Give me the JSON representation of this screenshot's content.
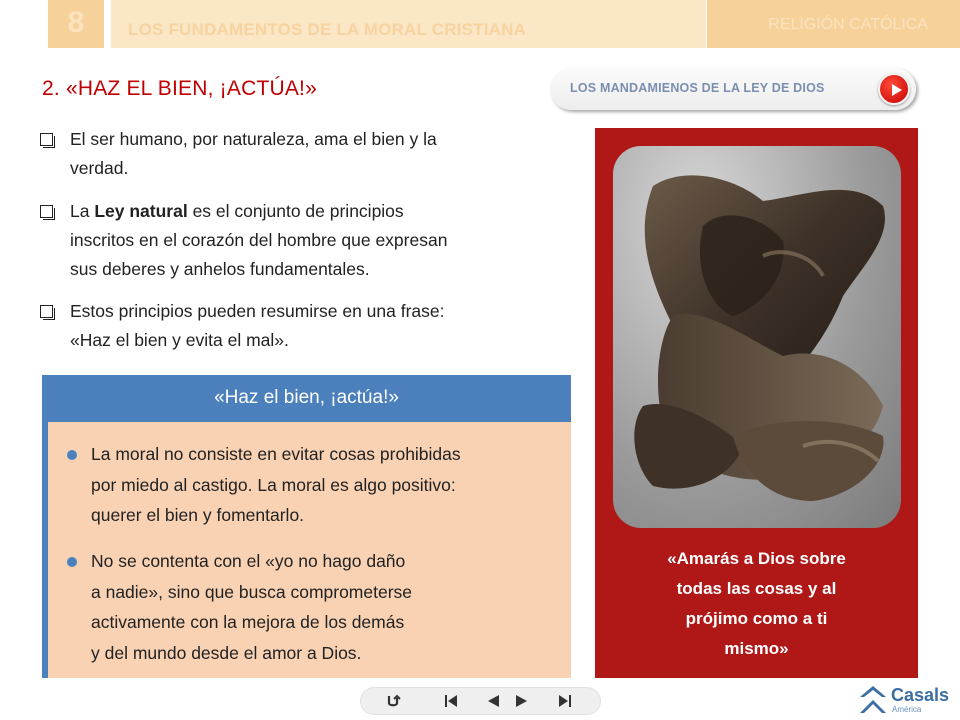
{
  "header": {
    "unit_number": "8",
    "unit_title": "LOS FUNDAMENTOS DE LA MORAL CRISTIANA",
    "subject": "RELIGIÓN CATÓLICA"
  },
  "section": {
    "title": "2. «HAZ EL BIEN, ¡ACTÚA!»"
  },
  "link_button": {
    "label": "LOS MANDAMIENOS DE LA LEY DE DIOS",
    "icon": "play-icon"
  },
  "bullets": [
    {
      "lines": [
        "El ser humano, por naturaleza, ama el bien y la",
        "verdad."
      ]
    },
    {
      "prefix": "La ",
      "bold": "Ley natural",
      "suffix": " es el conjunto de principios",
      "lines": [
        "inscritos en el corazón del hombre que expresan",
        "sus deberes y anhelos fundamentales."
      ]
    },
    {
      "lines": [
        "Estos principios pueden resumirse en una frase:",
        "«Haz el bien y evita el mal»."
      ]
    }
  ],
  "highlight_box": {
    "title": "«Haz el bien, ¡actúa!»",
    "items": [
      {
        "lines": [
          "La moral no consiste en evitar cosas prohibidas",
          "por miedo al castigo. La moral es algo positivo:",
          "querer el bien y fomentarlo."
        ]
      },
      {
        "lines": [
          "No se contenta con el «yo no hago daño",
          "a nadie», sino que busca comprometerse",
          "activamente con la mejora de los demás",
          "y del mundo desde el amor a Dios."
        ]
      }
    ]
  },
  "image_card": {
    "image": "bronze-hands-sculpture",
    "quote_lines": [
      "«Amarás a Dios sobre",
      "todas las cosas y al",
      "prójimo como a ti",
      "mismo»"
    ]
  },
  "nav": {
    "buttons": [
      "return-icon",
      "first-page-icon",
      "previous-icon",
      "next-icon",
      "last-page-icon"
    ]
  },
  "logo": {
    "name": "Casals",
    "sub": "América"
  },
  "colors": {
    "accent_red": "#c00000",
    "card_red": "#b01717",
    "box_blue": "#4b80bd",
    "box_peach": "#f9d2b4",
    "header_orange": "#f6d19a"
  }
}
